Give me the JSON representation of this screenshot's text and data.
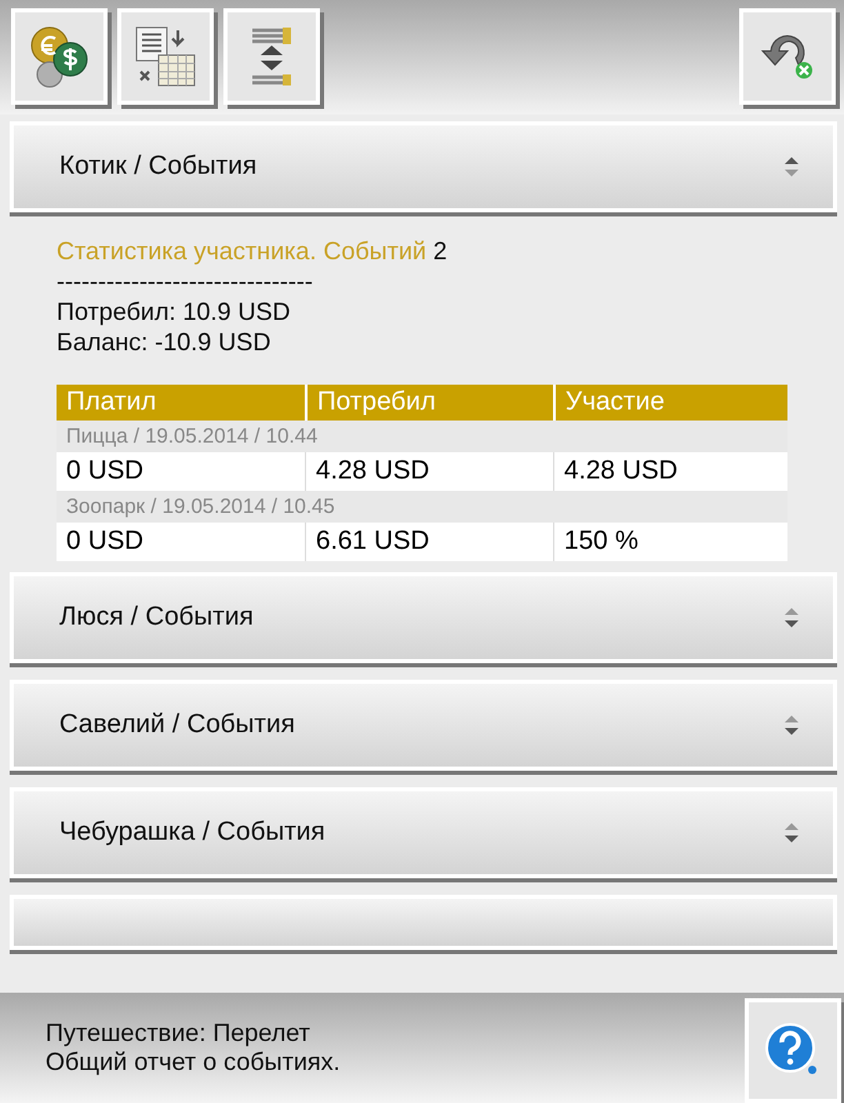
{
  "toolbar": {
    "left_buttons": [
      {
        "kind": "currency"
      },
      {
        "kind": "report"
      },
      {
        "kind": "sort"
      }
    ],
    "right_button": {
      "kind": "undo"
    }
  },
  "sections": [
    {
      "title": "Котик / События",
      "expanded": true,
      "stats": {
        "heading": "Статистика участника. Событий",
        "count": "2",
        "separator": "-------------------------------",
        "lines": [
          "Потребил: 10.9 USD",
          "Баланс: -10.9 USD"
        ],
        "table": {
          "columns": [
            "Платил",
            "Потребил",
            "Участие"
          ],
          "groups": [
            {
              "caption": "Пицца / 19.05.2014 / 10.44",
              "cells": [
                "0 USD",
                "4.28 USD",
                "4.28 USD"
              ]
            },
            {
              "caption": "Зоопарк / 19.05.2014 / 10.45",
              "cells": [
                "0 USD",
                "6.61 USD",
                "150 %"
              ]
            }
          ]
        }
      }
    },
    {
      "title": "Люся / События",
      "expanded": false
    },
    {
      "title": "Савелий / События",
      "expanded": false
    },
    {
      "title": "Чебурашка / События",
      "expanded": false
    }
  ],
  "footer": {
    "lines": [
      "Путешествие: Перелет",
      "Общий отчет о событиях."
    ],
    "button": {
      "kind": "help"
    }
  }
}
